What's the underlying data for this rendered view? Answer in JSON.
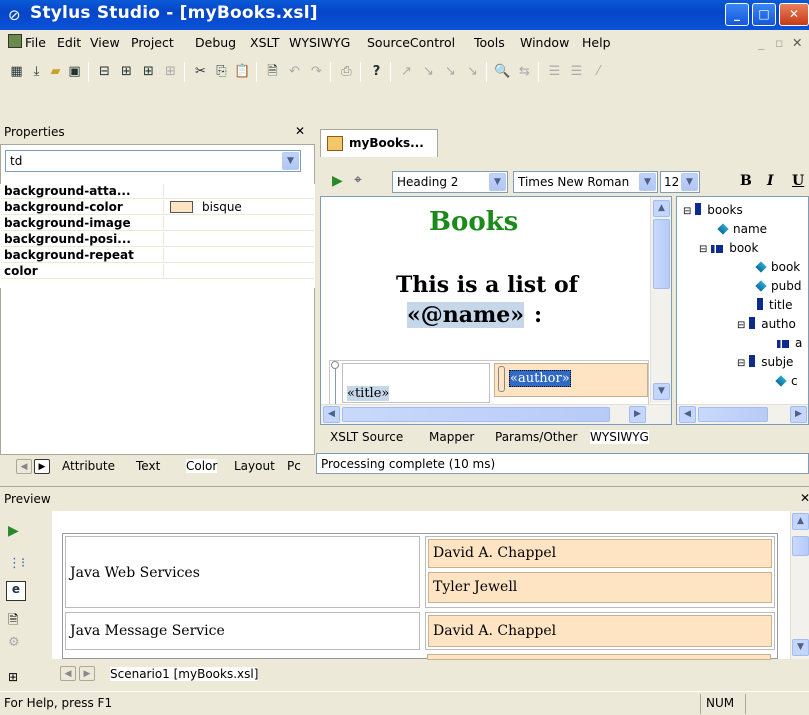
{
  "window": {
    "title": "Stylus Studio - [myBooks.xsl]"
  },
  "menu": [
    "File",
    "Edit",
    "View",
    "Project",
    "Debug",
    "XSLT",
    "WYSIWYG",
    "SourceControl",
    "Tools",
    "Window",
    "Help"
  ],
  "properties": {
    "title": "Properties",
    "selector": "td",
    "rows": [
      {
        "name": "background-atta...",
        "value": ""
      },
      {
        "name": "background-color",
        "value": "bisque",
        "swatch": "#ffe4c4"
      },
      {
        "name": "background-image",
        "value": ""
      },
      {
        "name": "background-posi...",
        "value": ""
      },
      {
        "name": "background-repeat",
        "value": ""
      },
      {
        "name": "color",
        "value": ""
      }
    ],
    "tabs": [
      "Attribute",
      "Text",
      "Color",
      "Layout",
      "Pc"
    ]
  },
  "editor": {
    "doc_tab": "myBooks...",
    "style_select": "Heading 2",
    "font_select": "Times New Roman",
    "size_select": "12",
    "bold": "B",
    "italic": "I",
    "underline": "U",
    "design": {
      "heading": "Books",
      "line1": "This is a list of",
      "line2_field": "«@name»",
      "line2_suffix": ":",
      "cell_title": "«title»",
      "cell_author": "«author»"
    },
    "tree": [
      {
        "label": "books",
        "kind": "element"
      },
      {
        "label": "name",
        "kind": "attribute"
      },
      {
        "label": "book",
        "kind": "repeat"
      },
      {
        "label": "book",
        "kind": "attribute"
      },
      {
        "label": "pubd",
        "kind": "attribute"
      },
      {
        "label": "title",
        "kind": "element"
      },
      {
        "label": "autho",
        "kind": "element"
      },
      {
        "label": "a",
        "kind": "repeat"
      },
      {
        "label": "subje",
        "kind": "element"
      },
      {
        "label": "c",
        "kind": "attribute"
      }
    ],
    "view_tabs": [
      "XSLT Source",
      "Mapper",
      "Params/Other",
      "WYSIWYG"
    ],
    "status": "Processing complete  (10 ms)"
  },
  "preview": {
    "title": "Preview",
    "rows": [
      {
        "title": "Java Web Services",
        "authors": [
          "David A. Chappel",
          "Tyler Jewell"
        ]
      },
      {
        "title": "Java Message Service",
        "authors": [
          "David A. Chappel"
        ]
      }
    ],
    "scenario_tab": "Scenario1 [myBooks.xsl]"
  },
  "statusbar": {
    "help": "For Help, press F1",
    "num": "NUM"
  },
  "colors": {
    "bisque": "#ffe4c4",
    "heading_green": "#1a8a1a",
    "titlebar": "#0a53d8"
  }
}
